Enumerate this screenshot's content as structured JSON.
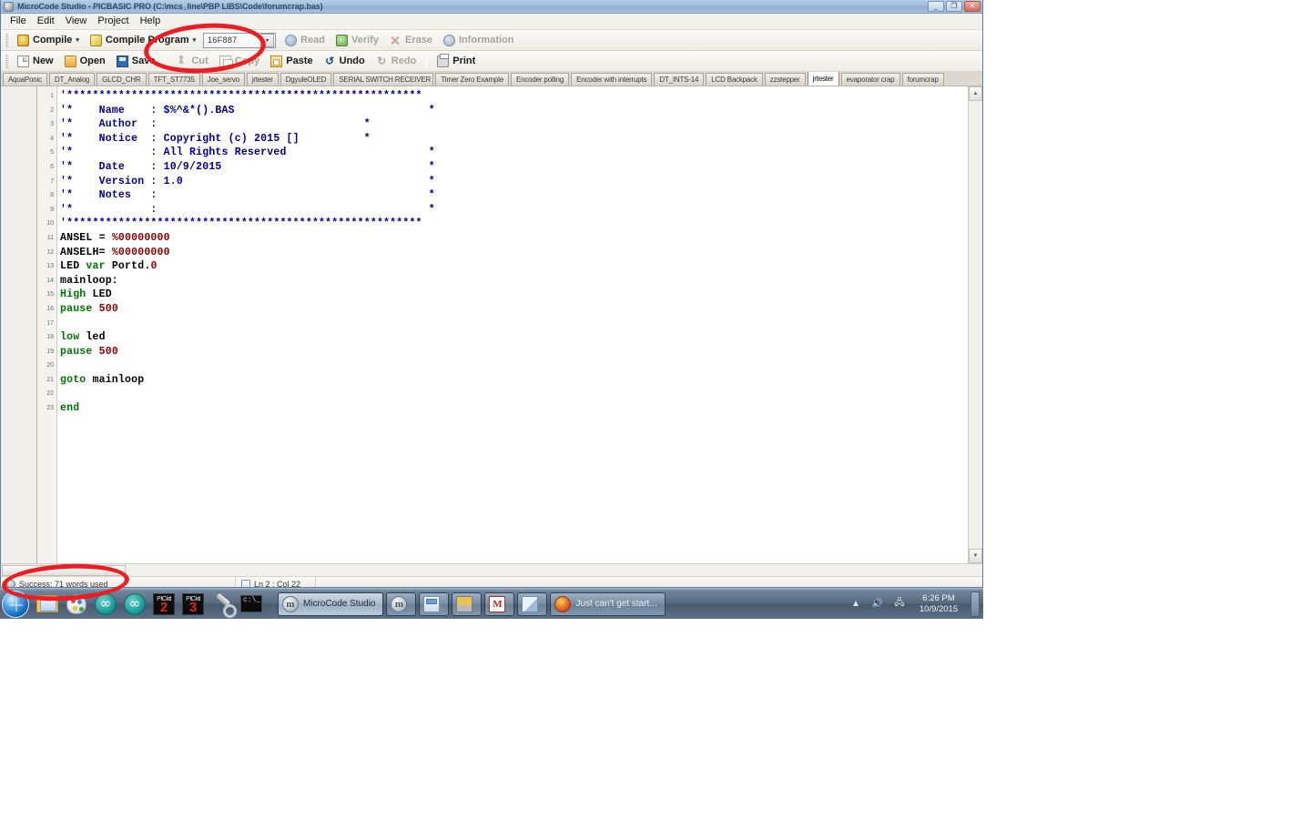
{
  "window": {
    "title": "MicroCode Studio - PICBASIC PRO (C:\\mcs_line\\PBP LIBS\\Code\\forumcrap.bas)",
    "icon": "app-icon",
    "controls": {
      "minimize": "_",
      "restore": "❐",
      "close": "✕"
    }
  },
  "menu": {
    "items": [
      {
        "label": "File"
      },
      {
        "label": "Edit"
      },
      {
        "label": "View"
      },
      {
        "label": "Project"
      },
      {
        "label": "Help"
      }
    ]
  },
  "toolbar_compile": {
    "compile": {
      "label": "Compile",
      "icon": "compile-icon",
      "caret": "▾"
    },
    "compile_program": {
      "label": "Compile Program",
      "icon": "compile-program-icon",
      "caret": "▾"
    },
    "device": {
      "value": "16F887",
      "arrow": "▾"
    },
    "read": {
      "label": "Read",
      "icon": "read-icon",
      "enabled": false
    },
    "verify": {
      "label": "Verify",
      "icon": "verify-icon",
      "enabled": false
    },
    "erase": {
      "label": "Erase",
      "icon": "erase-icon",
      "enabled": false
    },
    "information": {
      "label": "Information",
      "icon": "information-icon",
      "enabled": false
    }
  },
  "toolbar_edit": {
    "new": {
      "label": "New",
      "icon": "new-document-icon"
    },
    "open": {
      "label": "Open",
      "icon": "open-folder-icon"
    },
    "save": {
      "label": "Save",
      "icon": "save-disk-icon"
    },
    "cut": {
      "label": "Cut",
      "icon": "scissors-icon",
      "enabled": false
    },
    "copy": {
      "label": "Copy",
      "icon": "copy-icon",
      "enabled": false
    },
    "paste": {
      "label": "Paste",
      "icon": "paste-clipboard-icon",
      "enabled": true
    },
    "undo": {
      "label": "Undo",
      "icon": "undo-arrow-icon",
      "enabled": true,
      "glyph": "↺"
    },
    "redo": {
      "label": "Redo",
      "icon": "redo-arrow-icon",
      "enabled": false,
      "glyph": "↻"
    },
    "print": {
      "label": "Print",
      "icon": "printer-icon"
    }
  },
  "tabs": {
    "active_index": 14,
    "items": [
      {
        "label": "AquaPonic"
      },
      {
        "label": "DT_Analog"
      },
      {
        "label": "GLCD_CHR"
      },
      {
        "label": "TFT_ST7735"
      },
      {
        "label": "Joe_servo"
      },
      {
        "label": "jrtester"
      },
      {
        "label": "DgyuleOLED"
      },
      {
        "label": "SERIAL SWITCH RECEIVER"
      },
      {
        "label": "Timer Zero Example"
      },
      {
        "label": "Encoder polling"
      },
      {
        "label": "Encoder with interrupts"
      },
      {
        "label": "DT_INTS-14"
      },
      {
        "label": "LCD Backpack"
      },
      {
        "label": "zzstepper"
      },
      {
        "label": "jrtester"
      },
      {
        "label": "evaporator crap"
      },
      {
        "label": "forumcrap"
      }
    ]
  },
  "editor": {
    "lines": [
      {
        "num": "1",
        "tokens": [
          {
            "t": "'*******************************************************",
            "c": "comment"
          }
        ]
      },
      {
        "num": "2",
        "tokens": [
          {
            "t": "'*    Name    : $%^&*().BAS                              *",
            "c": "comment"
          }
        ]
      },
      {
        "num": "3",
        "tokens": [
          {
            "t": "'*    Author  :                                *",
            "c": "comment"
          }
        ]
      },
      {
        "num": "4",
        "tokens": [
          {
            "t": "'*    Notice  : Copyright (c) 2015 []          *",
            "c": "comment"
          }
        ]
      },
      {
        "num": "5",
        "tokens": [
          {
            "t": "'*            : All Rights Reserved                      *",
            "c": "comment"
          }
        ]
      },
      {
        "num": "6",
        "tokens": [
          {
            "t": "'*    Date    : 10/9/2015                                *",
            "c": "comment"
          }
        ]
      },
      {
        "num": "7",
        "tokens": [
          {
            "t": "'*    Version : 1.0                                      *",
            "c": "comment"
          }
        ]
      },
      {
        "num": "8",
        "tokens": [
          {
            "t": "'*    Notes   :                                          *",
            "c": "comment"
          }
        ]
      },
      {
        "num": "9",
        "tokens": [
          {
            "t": "'*            :                                          *",
            "c": "comment"
          }
        ]
      },
      {
        "num": "10",
        "tokens": [
          {
            "t": "'*******************************************************",
            "c": "comment"
          }
        ]
      },
      {
        "num": "11",
        "tokens": [
          {
            "t": "ANSEL = ",
            "c": "plain"
          },
          {
            "t": "%00000000",
            "c": "num"
          }
        ]
      },
      {
        "num": "12",
        "tokens": [
          {
            "t": "ANSELH= ",
            "c": "plain"
          },
          {
            "t": "%00000000",
            "c": "num"
          }
        ]
      },
      {
        "num": "13",
        "tokens": [
          {
            "t": "LED ",
            "c": "plain"
          },
          {
            "t": "var",
            "c": "kw"
          },
          {
            "t": " Portd.",
            "c": "plain"
          },
          {
            "t": "0",
            "c": "num"
          }
        ]
      },
      {
        "num": "14",
        "tokens": [
          {
            "t": "mainloop:",
            "c": "plain"
          }
        ]
      },
      {
        "num": "15",
        "tokens": [
          {
            "t": "High",
            "c": "kw"
          },
          {
            "t": " LED",
            "c": "plain"
          }
        ]
      },
      {
        "num": "16",
        "tokens": [
          {
            "t": "pause",
            "c": "kw"
          },
          {
            "t": " ",
            "c": "plain"
          },
          {
            "t": "500",
            "c": "num"
          }
        ]
      },
      {
        "num": "17",
        "tokens": [
          {
            "t": "",
            "c": "plain"
          }
        ]
      },
      {
        "num": "18",
        "tokens": [
          {
            "t": "low",
            "c": "kw"
          },
          {
            "t": " led",
            "c": "plain"
          }
        ]
      },
      {
        "num": "19",
        "tokens": [
          {
            "t": "pause",
            "c": "kw"
          },
          {
            "t": " ",
            "c": "plain"
          },
          {
            "t": "500",
            "c": "num"
          }
        ]
      },
      {
        "num": "20",
        "tokens": [
          {
            "t": "",
            "c": "plain"
          }
        ]
      },
      {
        "num": "21",
        "tokens": [
          {
            "t": "goto",
            "c": "kw"
          },
          {
            "t": " mainloop",
            "c": "plain"
          }
        ]
      },
      {
        "num": "22",
        "tokens": [
          {
            "t": "",
            "c": "plain"
          }
        ]
      },
      {
        "num": "23",
        "tokens": [
          {
            "t": "end",
            "c": "kw"
          }
        ]
      }
    ],
    "scroll": {
      "up_arrow": "▲",
      "down_arrow": "▼",
      "left_arrow": "◄"
    }
  },
  "status_bar": {
    "message": "Success: 71 words used",
    "message_icon": "info-circle-icon",
    "position": "Ln 2 : Col 22",
    "position_icon": "page-icon"
  },
  "taskbar": {
    "start": {
      "name": "start-orb"
    },
    "quick_launch": [
      {
        "name": "file-explorer-icon",
        "kind": "explorer"
      },
      {
        "name": "paint-icon",
        "kind": "paint"
      },
      {
        "name": "arduino-ide-icon",
        "kind": "arduino"
      },
      {
        "name": "arduino-ide-2-icon",
        "kind": "arduino"
      },
      {
        "name": "pickit2-icon",
        "kind": "pickit",
        "top": "PICkit",
        "num": "2"
      },
      {
        "name": "pickit3-icon",
        "kind": "pickit",
        "top": "PICkit",
        "num": "3"
      },
      {
        "name": "tools-wrench-icon",
        "kind": "wrench"
      },
      {
        "name": "command-prompt-icon",
        "kind": "cmd",
        "glyph": "c:\\_"
      }
    ],
    "buttons": [
      {
        "label": "MicroCode Studio",
        "icon": "mcs-logo-icon",
        "kind": "mcs",
        "active": true
      },
      {
        "label": "",
        "icon": "mcs-logo-icon",
        "kind": "mcs",
        "active": false
      },
      {
        "label": "",
        "icon": "calculator-icon",
        "kind": "calc",
        "active": false
      },
      {
        "label": "",
        "icon": "laptop-icon",
        "kind": "laptop",
        "active": false
      },
      {
        "label": "",
        "icon": "mpasm-icon",
        "kind": "mpasm",
        "active": false
      },
      {
        "label": "",
        "icon": "notepad-icon",
        "kind": "notepad",
        "active": false
      },
      {
        "label": "Just can't get start...",
        "icon": "firefox-icon",
        "kind": "firefox",
        "active": false
      }
    ],
    "tray": {
      "show_hidden": "▲",
      "volume": "🔊",
      "network": "🖧",
      "time": "6:26 PM",
      "date": "10/9/2015"
    }
  },
  "annotations": [
    {
      "name": "toolbar-highlight-ellipse",
      "color": "#ee1b22"
    },
    {
      "name": "status-highlight-ellipse",
      "color": "#ee1b22"
    }
  ]
}
